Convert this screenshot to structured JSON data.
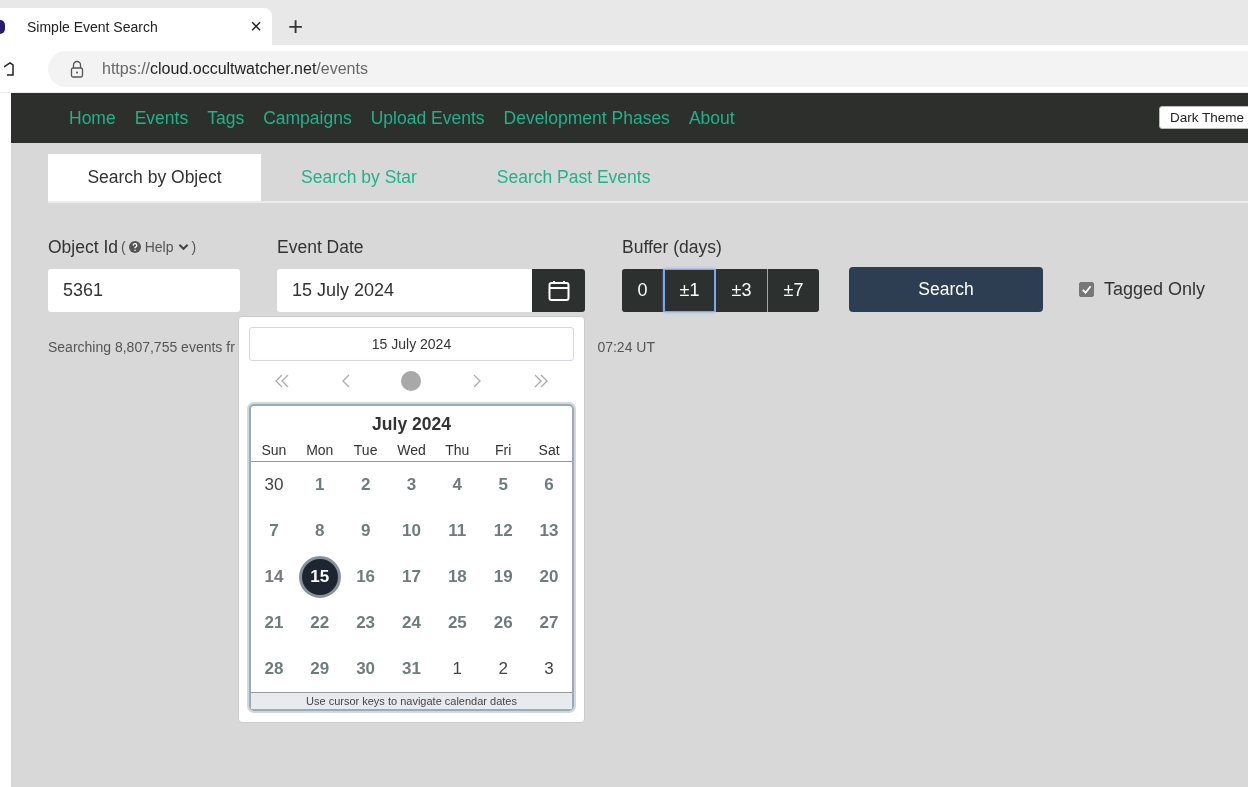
{
  "browser": {
    "tab_title": "Simple Event Search",
    "close_glyph": "×",
    "new_tab_glyph": "+",
    "url": {
      "scheme": "https://",
      "host": "cloud.occultwatcher.net",
      "path": "/events"
    }
  },
  "nav": {
    "links": [
      "Home",
      "Events",
      "Tags",
      "Campaigns",
      "Upload Events",
      "Development Phases",
      "About"
    ],
    "theme_button": "Dark Theme"
  },
  "tabs": [
    {
      "label": "Search by Object",
      "selected": true
    },
    {
      "label": "Search by Star",
      "selected": false
    },
    {
      "label": "Search Past Events",
      "selected": false
    }
  ],
  "form": {
    "object_label": "Object Id",
    "help_open": "(",
    "help_label": "Help",
    "help_close": ")",
    "object_value": "5361",
    "date_label": "Event Date",
    "date_value": "15 July 2024",
    "buffer_label": "Buffer (days)",
    "buffers": [
      {
        "label": "0",
        "selected": false
      },
      {
        "label": "±1",
        "selected": true
      },
      {
        "label": "±3",
        "selected": false
      },
      {
        "label": "±7",
        "selected": false
      }
    ],
    "search_button": "Search",
    "tagged_only": {
      "label": "Tagged Only",
      "checked": true
    }
  },
  "status": {
    "left": "Searching 8,807,755 events fr",
    "right": "07:24 UT"
  },
  "datepicker": {
    "value": "15 July 2024",
    "title": "July 2024",
    "weekdays": [
      "Sun",
      "Mon",
      "Tue",
      "Wed",
      "Thu",
      "Fri",
      "Sat"
    ],
    "weeks": [
      [
        {
          "day": "30",
          "outside": true,
          "selected": false
        },
        {
          "day": "1",
          "outside": false,
          "selected": false
        },
        {
          "day": "2",
          "outside": false,
          "selected": false
        },
        {
          "day": "3",
          "outside": false,
          "selected": false
        },
        {
          "day": "4",
          "outside": false,
          "selected": false
        },
        {
          "day": "5",
          "outside": false,
          "selected": false
        },
        {
          "day": "6",
          "outside": false,
          "selected": false
        }
      ],
      [
        {
          "day": "7",
          "outside": false,
          "selected": false
        },
        {
          "day": "8",
          "outside": false,
          "selected": false
        },
        {
          "day": "9",
          "outside": false,
          "selected": false
        },
        {
          "day": "10",
          "outside": false,
          "selected": false
        },
        {
          "day": "11",
          "outside": false,
          "selected": false
        },
        {
          "day": "12",
          "outside": false,
          "selected": false
        },
        {
          "day": "13",
          "outside": false,
          "selected": false
        }
      ],
      [
        {
          "day": "14",
          "outside": false,
          "selected": false
        },
        {
          "day": "15",
          "outside": false,
          "selected": true
        },
        {
          "day": "16",
          "outside": false,
          "selected": false
        },
        {
          "day": "17",
          "outside": false,
          "selected": false
        },
        {
          "day": "18",
          "outside": false,
          "selected": false
        },
        {
          "day": "19",
          "outside": false,
          "selected": false
        },
        {
          "day": "20",
          "outside": false,
          "selected": false
        }
      ],
      [
        {
          "day": "21",
          "outside": false,
          "selected": false
        },
        {
          "day": "22",
          "outside": false,
          "selected": false
        },
        {
          "day": "23",
          "outside": false,
          "selected": false
        },
        {
          "day": "24",
          "outside": false,
          "selected": false
        },
        {
          "day": "25",
          "outside": false,
          "selected": false
        },
        {
          "day": "26",
          "outside": false,
          "selected": false
        },
        {
          "day": "27",
          "outside": false,
          "selected": false
        }
      ],
      [
        {
          "day": "28",
          "outside": false,
          "selected": false
        },
        {
          "day": "29",
          "outside": false,
          "selected": false
        },
        {
          "day": "30",
          "outside": false,
          "selected": false
        },
        {
          "day": "31",
          "outside": false,
          "selected": false
        },
        {
          "day": "1",
          "outside": true,
          "selected": false
        },
        {
          "day": "2",
          "outside": true,
          "selected": false
        },
        {
          "day": "3",
          "outside": true,
          "selected": false
        }
      ]
    ],
    "footer": "Use cursor keys to navigate calendar dates"
  }
}
